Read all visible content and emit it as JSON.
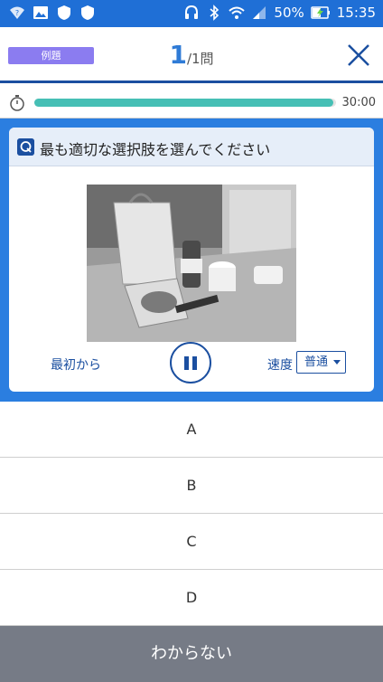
{
  "status_bar": {
    "battery_percent": "50%",
    "time": "15:35",
    "icons": [
      "question-wifi-icon",
      "image-icon",
      "shield-icon",
      "shield-icon",
      "headphones-icon",
      "bluetooth-icon",
      "wifi-icon",
      "signal-icon",
      "battery-charging-icon"
    ]
  },
  "header": {
    "badge": "例題",
    "current": "1",
    "total": "/1問",
    "close_icon": "close-icon"
  },
  "timer": {
    "progress": 0.99,
    "time_text": "30:00"
  },
  "question": {
    "title": "最も適切な選択肢を選んでください",
    "restart_label": "最初から",
    "speed_label": "速度",
    "speed_value": "普通"
  },
  "options": [
    "A",
    "B",
    "C",
    "D"
  ],
  "footer": {
    "label": "わからない"
  },
  "colors": {
    "status_bar": "#1f6fd6",
    "accent": "#1b4fa0",
    "badge": "#8b7cf0",
    "progress": "#46bfb5",
    "question_bg": "#2b7ee0",
    "footer": "#767b86"
  }
}
